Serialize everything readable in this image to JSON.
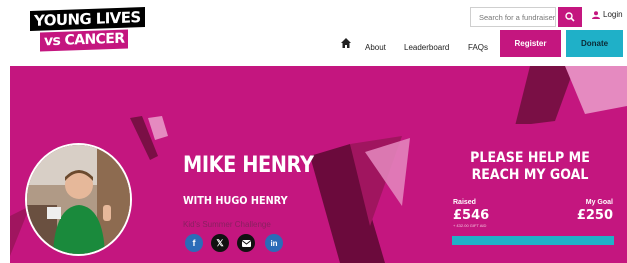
{
  "brand": {
    "logo_line1": "YOUNG LIVES",
    "logo_line2": "vs CANCER",
    "primary": "#c4167f",
    "accent": "#1fb0c8"
  },
  "header": {
    "search_placeholder": "Search for a fundraiser",
    "search_icon": "search-icon",
    "login_label": "Login",
    "nav": {
      "about": "About",
      "leaderboard": "Leaderboard",
      "faqs": "FAQs"
    },
    "register_label": "Register",
    "donate_label": "Donate"
  },
  "profile": {
    "name": "MIKE HENRY",
    "with": "WITH HUGO HENRY",
    "event": "Kid's Summer Challenge",
    "social": [
      "facebook-icon",
      "x-icon",
      "mail-icon",
      "linkedin-icon"
    ]
  },
  "goal": {
    "title_line1": "PLEASE HELP ME",
    "title_line2": "REACH MY GOAL",
    "raised_label": "Raised",
    "raised_value": "£546",
    "raised_sub": "+ £32.00 GIFT AID",
    "goal_label": "My Goal",
    "goal_value": "£250",
    "progress_fraction": 1.0
  }
}
